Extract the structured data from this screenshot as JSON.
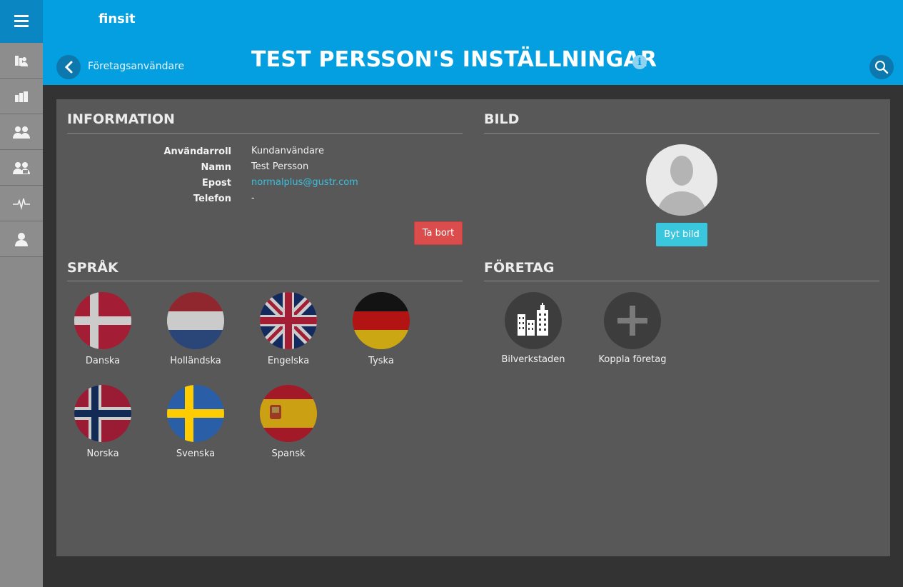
{
  "app": {
    "brand": "finsit"
  },
  "header": {
    "breadcrumb": "Företagsanvändare",
    "title": "TEST PERSSON'S INSTÄLLNINGAR"
  },
  "sidebar": {
    "items": [
      {
        "icon": "business-people-icon"
      },
      {
        "icon": "buildings-icon"
      },
      {
        "icon": "users-icon"
      },
      {
        "icon": "user-group-icon"
      },
      {
        "icon": "activity-icon"
      },
      {
        "icon": "person-icon"
      }
    ]
  },
  "information": {
    "title": "INFORMATION",
    "fields": [
      {
        "label": "Användarroll",
        "value": "Kundanvändare"
      },
      {
        "label": "Namn",
        "value": "Test Persson"
      },
      {
        "label": "Epost",
        "value": "normalplus@gustr.com"
      },
      {
        "label": "Telefon",
        "value": "-"
      }
    ],
    "delete_label": "Ta bort"
  },
  "picture": {
    "title": "BILD",
    "change_label": "Byt bild"
  },
  "languages": {
    "title": "SPRÅK",
    "items": [
      {
        "label": "Danska",
        "flag": "dk"
      },
      {
        "label": "Holländska",
        "flag": "nl"
      },
      {
        "label": "Engelska",
        "flag": "gb"
      },
      {
        "label": "Tyska",
        "flag": "de"
      },
      {
        "label": "Norska",
        "flag": "no"
      },
      {
        "label": "Svenska",
        "flag": "se"
      },
      {
        "label": "Spansk",
        "flag": "es"
      }
    ]
  },
  "companies": {
    "title": "FÖRETAG",
    "items": [
      {
        "label": "Bilverkstaden",
        "icon": "buildings-icon"
      },
      {
        "label": "Koppla företag",
        "icon": "plus-icon"
      }
    ]
  },
  "colors": {
    "header": "#039fe0",
    "sidebar": "#8a8a8a",
    "panel": "#585858",
    "delete": "#db4d4d",
    "accent": "#3ac6dc",
    "link": "#38c0de"
  }
}
